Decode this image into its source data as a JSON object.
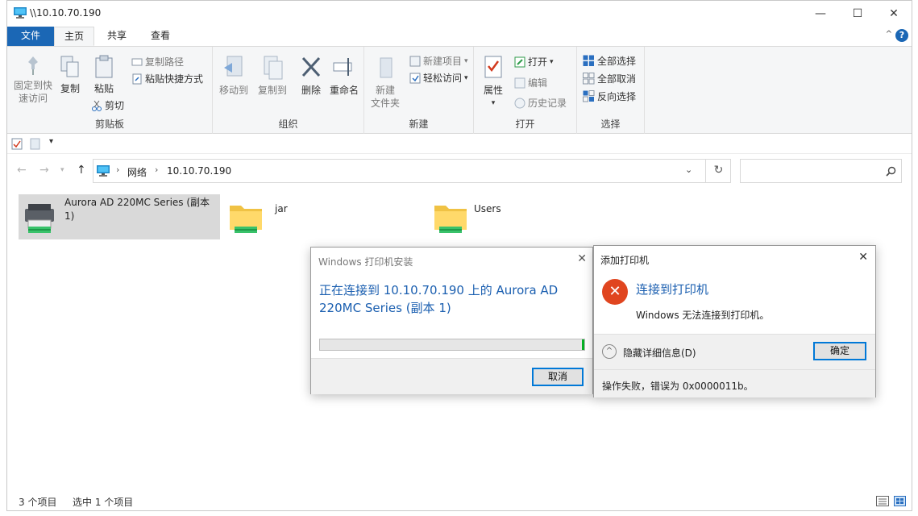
{
  "window": {
    "title": "\\\\10.10.70.190",
    "controls": {
      "minimize": "—",
      "maximize": "☐",
      "close": "✕"
    }
  },
  "tabs": [
    "文件",
    "主页",
    "共享",
    "查看"
  ],
  "ribbon": {
    "clipboard": {
      "label": "剪贴板",
      "pin_line1": "固定到快",
      "pin_line2": "速访问",
      "copy": "复制",
      "paste": "粘贴",
      "copy_path": "复制路径",
      "paste_shortcut": "粘贴快捷方式",
      "cut": "剪切"
    },
    "organize": {
      "label": "组织",
      "move_to": "移动到",
      "copy_to": "复制到",
      "delete": "删除",
      "rename": "重命名"
    },
    "new": {
      "label": "新建",
      "new_folder_line1": "新建",
      "new_folder_line2": "文件夹",
      "new_item": "新建项目",
      "easy_access": "轻松访问"
    },
    "open": {
      "label": "打开",
      "properties": "属性",
      "open": "打开",
      "edit": "编辑",
      "history": "历史记录"
    },
    "select": {
      "label": "选择",
      "select_all": "全部选择",
      "select_none": "全部取消",
      "invert": "反向选择"
    }
  },
  "address": {
    "crumbs": [
      "网络",
      "10.10.70.190"
    ]
  },
  "items": [
    {
      "name": "Aurora AD 220MC Series (副本 1)",
      "line1": "Aurora AD 220MC Series (副本",
      "line2": "1)",
      "type": "printer"
    },
    {
      "name": "jar",
      "type": "folder"
    },
    {
      "name": "Users",
      "type": "folder"
    }
  ],
  "status": {
    "count": "3 个项目",
    "selected": "选中 1 个项目"
  },
  "dialog_install": {
    "title": "Windows 打印机安装",
    "message": "正在连接到 10.10.70.190 上的 Aurora AD 220MC Series (副本 1)",
    "progress": 0.01,
    "cancel": "取消"
  },
  "dialog_error": {
    "title": "添加打印机",
    "heading": "连接到打印机",
    "message": "Windows 无法连接到打印机。",
    "toggle": "隐藏详细信息(D)",
    "ok": "确定",
    "detail": "操作失败，错误为 0x0000011b。"
  },
  "colors": {
    "accent": "#1b67b5",
    "link_blue": "#1b5fb0",
    "error_red": "#e0451f",
    "progress_green": "#06b025"
  }
}
